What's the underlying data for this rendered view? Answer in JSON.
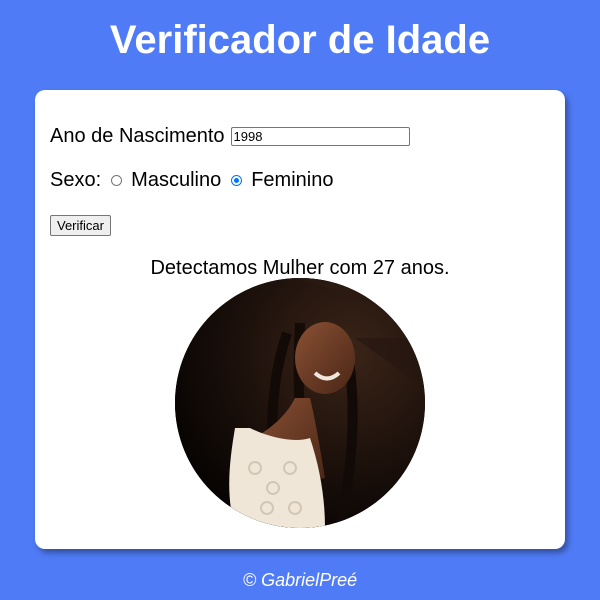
{
  "header": {
    "title": "Verificador de Idade"
  },
  "form": {
    "birth_year_label": "Ano de Nascimento",
    "birth_year_value": "1998",
    "sex_label": "Sexo:",
    "sex_options": [
      {
        "label": "Masculino",
        "checked": false
      },
      {
        "label": "Feminino",
        "checked": true
      }
    ],
    "submit_label": "Verificar"
  },
  "result": {
    "message": "Detectamos Mulher com 27 anos."
  },
  "footer": {
    "text": "© GabrielPreé"
  },
  "colors": {
    "page_background": "#4f7bf6",
    "card_background": "#ffffff",
    "radio_accent": "#0075ff"
  }
}
